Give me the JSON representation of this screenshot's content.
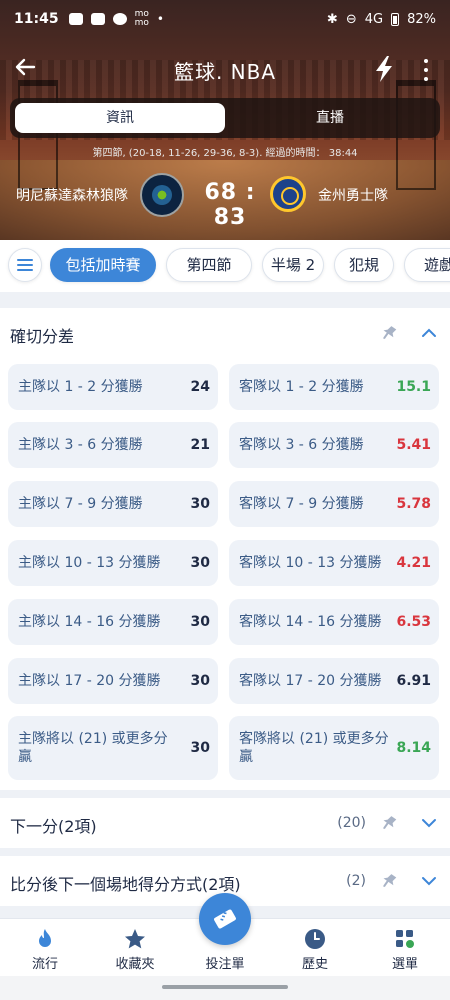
{
  "status_bar": {
    "time": "11:45",
    "battery": "82%",
    "network": "4G"
  },
  "header": {
    "title": "籃球. NBA"
  },
  "tabs": [
    {
      "label": "資訊",
      "active": true
    },
    {
      "label": "直播",
      "active": false
    }
  ],
  "match": {
    "info": "第四節, (20-18, 11-26, 29-36, 8-3). 經過的時間： 38:44",
    "home_team": "明尼蘇達森林狼隊",
    "away_team": "金州勇士隊",
    "score": "68 : 83"
  },
  "filters": [
    {
      "label": "包括加時賽",
      "active": true
    },
    {
      "label": "第四節",
      "active": false
    },
    {
      "label": "半場 2",
      "active": false
    },
    {
      "label": "犯規",
      "active": false
    },
    {
      "label": "遊戲",
      "active": false
    }
  ],
  "markets": {
    "exact_margin": {
      "title": "確切分差",
      "rows": [
        {
          "home_label": "主隊以 1 - 2 分獲勝",
          "home_odds": "24",
          "away_label": "客隊以 1 - 2 分獲勝",
          "away_odds": "15.1",
          "away_color": "#3aa655"
        },
        {
          "home_label": "主隊以 3 - 6 分獲勝",
          "home_odds": "21",
          "away_label": "客隊以 3 - 6 分獲勝",
          "away_odds": "5.41",
          "away_color": "#d9363e"
        },
        {
          "home_label": "主隊以 7 - 9 分獲勝",
          "home_odds": "30",
          "away_label": "客隊以 7 - 9 分獲勝",
          "away_odds": "5.78",
          "away_color": "#d9363e"
        },
        {
          "home_label": "主隊以 10 - 13 分獲勝",
          "home_odds": "30",
          "away_label": "客隊以 10 - 13 分獲勝",
          "away_odds": "4.21",
          "away_color": "#d9363e"
        },
        {
          "home_label": "主隊以 14 - 16 分獲勝",
          "home_odds": "30",
          "away_label": "客隊以 14 - 16 分獲勝",
          "away_odds": "6.53",
          "away_color": "#d9363e"
        },
        {
          "home_label": "主隊以 17 - 20 分獲勝",
          "home_odds": "30",
          "away_label": "客隊以 17 - 20 分獲勝",
          "away_odds": "6.91",
          "away_color": "#1f2a44"
        },
        {
          "home_label": "主隊將以 (21) 或更多分贏",
          "home_odds": "30",
          "away_label": "客隊將以 (21) 或更多分贏",
          "away_odds": "8.14",
          "away_color": "#3aa655"
        }
      ]
    },
    "next_point": {
      "title": "下一分(2項)",
      "count": "(20)"
    },
    "next_score_method": {
      "title": "比分後下一個場地得分方式(2項)",
      "count": "(2)"
    }
  },
  "nav": [
    {
      "label": "流行",
      "icon": "fire-icon"
    },
    {
      "label": "收藏夾",
      "icon": "star-icon"
    },
    {
      "label": "投注單",
      "icon": "ticket-icon"
    },
    {
      "label": "歷史",
      "icon": "clock-icon"
    },
    {
      "label": "選單",
      "icon": "grid-menu-icon"
    }
  ],
  "colors": {
    "accent": "#3d86d8",
    "up": "#3aa655",
    "down": "#d9363e"
  }
}
